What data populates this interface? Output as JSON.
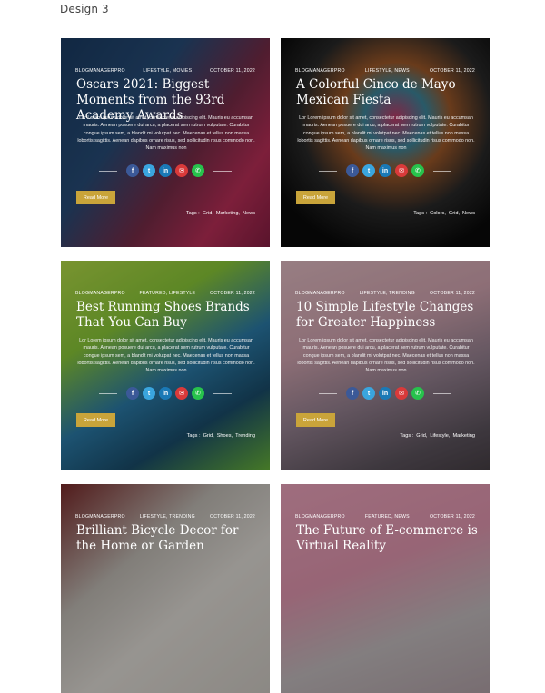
{
  "page": {
    "label": "Design 3"
  },
  "share_icons": [
    "facebook-icon",
    "twitter-icon",
    "linkedin-icon",
    "mail-icon",
    "whatsapp-icon"
  ],
  "excerpt": "Lor Lorem ipsum dolor sit amet, consectetur adipiscing elit. Mauris eu accumsan mauris. Aenean posuere dui arcu, a placerat sem rutrum vulputate. Curabitur congue ipsum sem, a blandit mi volutpat nec. Maecenas et tellus non massa lobortis sagittis. Aenean dapibus ornare risus, sed sollicitudin risus commodo non. Nam maximus non",
  "read_more": "Read More",
  "tags_label": "Tags :",
  "colors": {
    "accent": "#c9a43a"
  },
  "cards": [
    {
      "category_author": "BLOGMANAGERPRO",
      "categories": "LIFESTYLE, MOVIES",
      "date": "OCTOBER 11, 2022",
      "title": "Oscars 2021: Biggest Moments from the 93rd Academy Awards",
      "tags": [
        "Grid,",
        "Marketing,",
        "News"
      ]
    },
    {
      "category_author": "BLOGMANAGERPRO",
      "categories": "LIFESTYLE, NEWS",
      "date": "OCTOBER 11, 2022",
      "title": "A Colorful Cinco de Mayo Mexican Fiesta",
      "tags": [
        "Colors,",
        "Grid,",
        "News"
      ]
    },
    {
      "category_author": "BLOGMANAGERPRO",
      "categories": "FEATURED, LIFESTYLE",
      "date": "OCTOBER 11, 2022",
      "title": "Best Running Shoes Brands That You Can Buy",
      "tags": [
        "Grid,",
        "Shoes,",
        "Trending"
      ]
    },
    {
      "category_author": "BLOGMANAGERPRO",
      "categories": "LIFESTYLE, TRENDING",
      "date": "OCTOBER 11, 2022",
      "title": "10 Simple Lifestyle Changes for Greater Happiness",
      "tags": [
        "Grid,",
        "Lifestyle,",
        "Marketing"
      ]
    },
    {
      "category_author": "BLOGMANAGERPRO",
      "categories": "LIFESTYLE, TRENDING",
      "date": "OCTOBER 11, 2022",
      "title": "Brilliant Bicycle Decor for the Home or Garden",
      "tags": []
    },
    {
      "category_author": "BLOGMANAGERPRO",
      "categories": "FEATURED, NEWS",
      "date": "OCTOBER 11, 2022",
      "title": "The Future of E-commerce is Virtual Reality",
      "tags": []
    }
  ]
}
